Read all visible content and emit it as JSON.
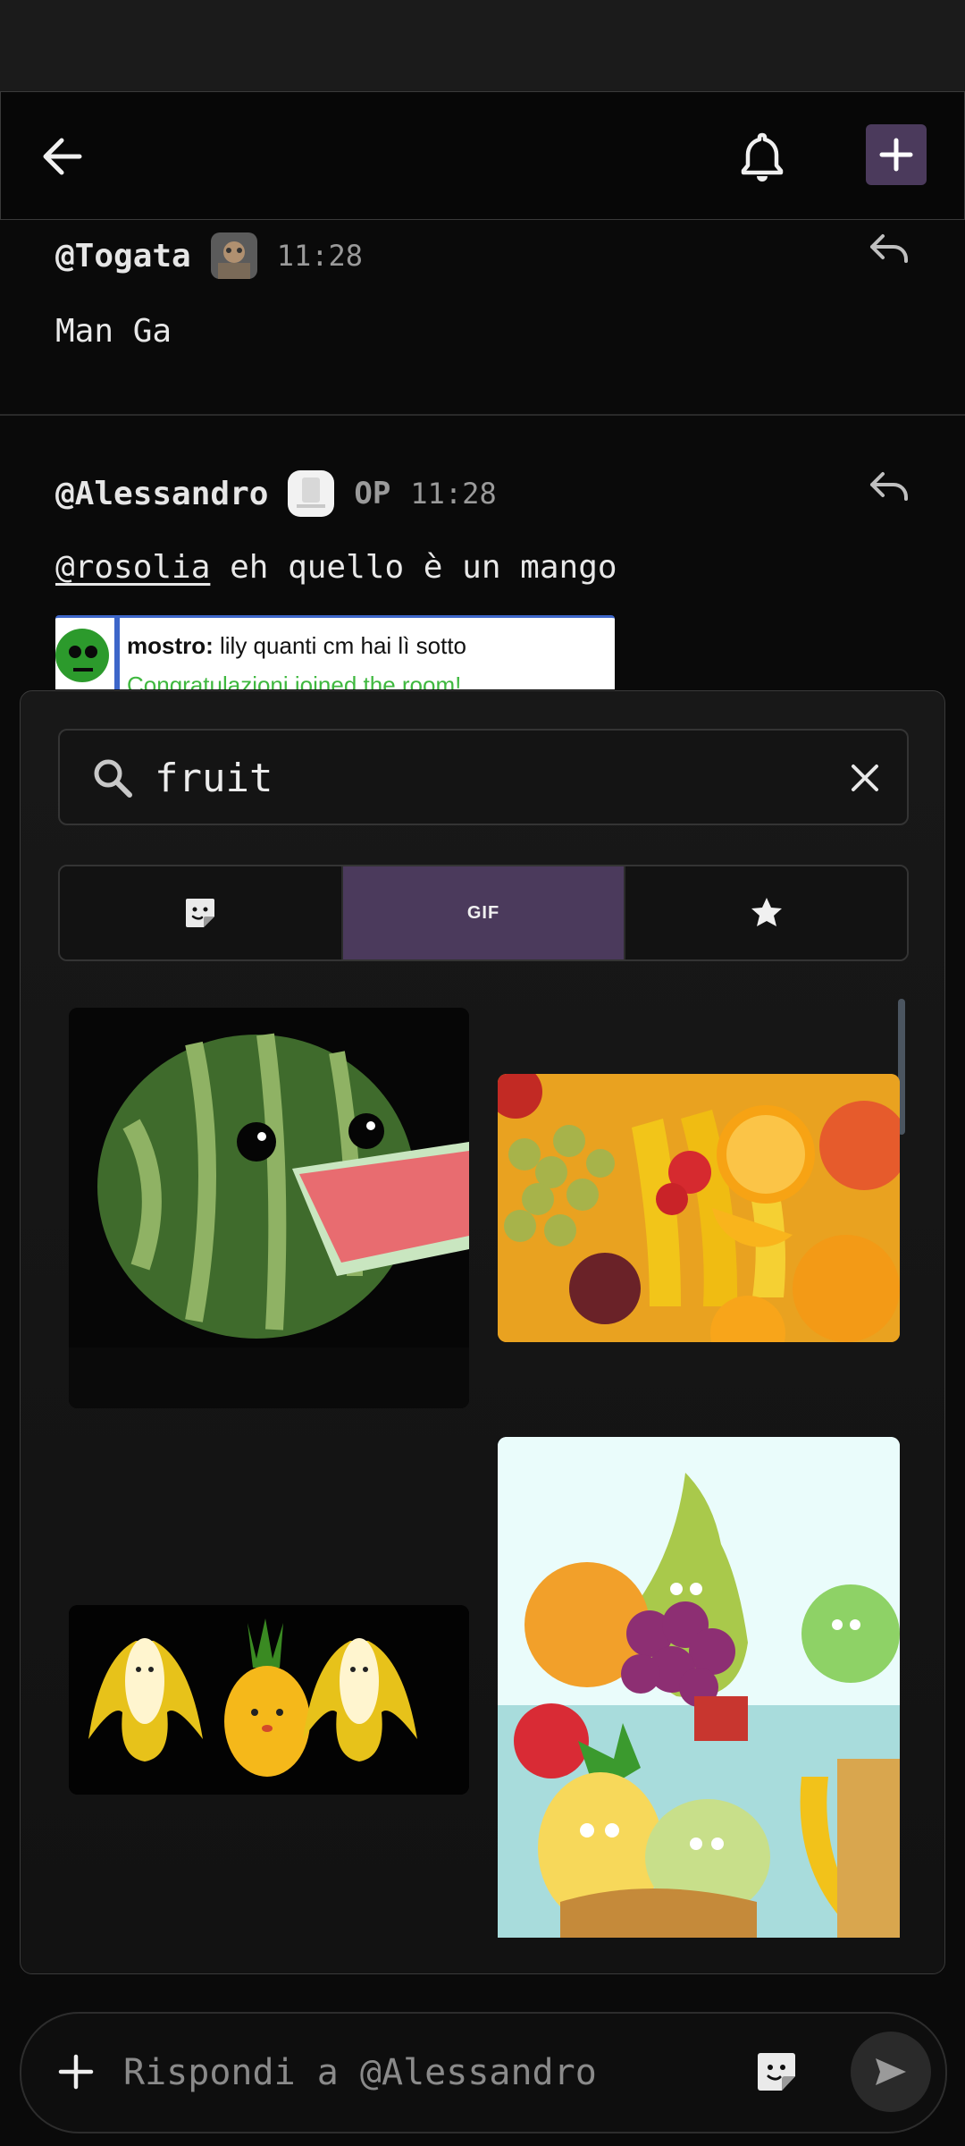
{
  "messages": [
    {
      "author": "@Togata",
      "time": "11:28",
      "text": "Man Ga"
    },
    {
      "author": "@Alessandro",
      "badge": "OP",
      "time": "11:28",
      "mention": "@rosolia",
      "text": " eh quello è un mango",
      "embed": {
        "name": "mostro:",
        "text": " lily quanti cm hai lì sotto",
        "second_line": "Congratulazioni joined the room!"
      }
    }
  ],
  "picker": {
    "search_value": "fruit",
    "tabs": [
      {
        "icon": "sticker-icon"
      },
      {
        "label": "GIF",
        "active": true
      },
      {
        "icon": "star-icon"
      }
    ],
    "results": [
      "watermelon-gif",
      "fruit-pile-gif",
      "banana-pineapple-gif",
      "cartoon-fruits-gif"
    ]
  },
  "composer": {
    "placeholder": "Rispondi a @Alessandro"
  },
  "colors": {
    "accent": "#4b3a5c",
    "background": "#0a0a0a"
  }
}
